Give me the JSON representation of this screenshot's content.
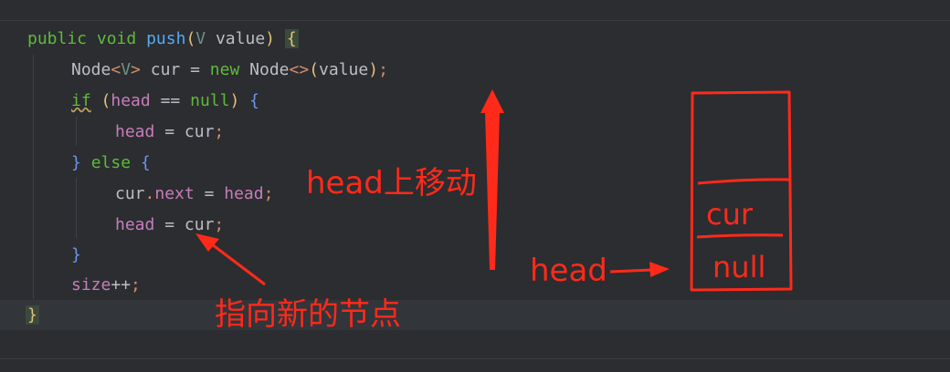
{
  "code": {
    "line1": {
      "kw1": "public",
      "kw2": "void",
      "name": "push",
      "open": "(",
      "type": "V",
      "param": "value",
      "close": ")",
      "brace": "{"
    },
    "line2": {
      "node1": "Node",
      "lt": "<",
      "v": "V",
      "gt": ">",
      "var": "cur",
      "eq": "=",
      "new": "new",
      "node2": "Node",
      "diamond": "<>",
      "open": "(",
      "arg": "value",
      "close": ")",
      "semi": ";"
    },
    "line3": {
      "if": "if",
      "open": "(",
      "head": "head",
      "op": "==",
      "null": "null",
      "close": ")",
      "brace": "{"
    },
    "line4": {
      "head": "head",
      "eq": "=",
      "cur": "cur",
      "semi": ";"
    },
    "line5": {
      "brace": "}",
      "else": "else",
      "open": "{"
    },
    "line6": {
      "cur": "cur",
      "dot": ".",
      "next": "next",
      "eq": "=",
      "head": "head",
      "semi": ";"
    },
    "line7": {
      "head": "head",
      "eq": "=",
      "cur": "cur",
      "semi": ";"
    },
    "line8": {
      "brace": "}"
    },
    "line9": {
      "size": "size",
      "inc": "++",
      "semi": ";"
    },
    "line10": {
      "brace": "}"
    }
  },
  "annotations": {
    "head_moves_up": "head上移动",
    "points_to_new_node": "指向新的节点",
    "head_label": "head",
    "stack_cur": "cur",
    "stack_null": "null",
    "color": "#ff2a1a"
  }
}
